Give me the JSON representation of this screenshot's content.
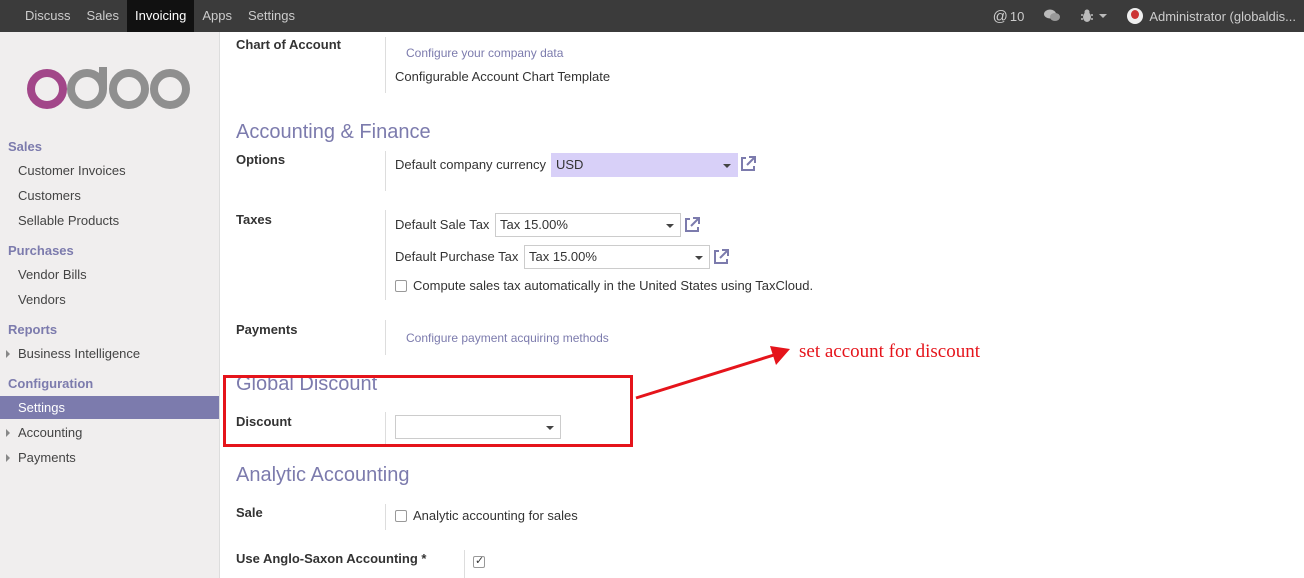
{
  "topbar": {
    "menu": [
      "Discuss",
      "Sales",
      "Invoicing",
      "Apps",
      "Settings"
    ],
    "active": "Invoicing",
    "mentions_count": "10",
    "user": "Administrator (globaldis..."
  },
  "logo_text": "odoo",
  "sidebar": {
    "sales_header": "Sales",
    "customer_invoices": "Customer Invoices",
    "customers": "Customers",
    "sellable_products": "Sellable Products",
    "purchases_header": "Purchases",
    "vendor_bills": "Vendor Bills",
    "vendors": "Vendors",
    "reports_header": "Reports",
    "business_intelligence": "Business Intelligence",
    "configuration_header": "Configuration",
    "settings": "Settings",
    "accounting": "Accounting",
    "payments": "Payments"
  },
  "content": {
    "chart_of_account_label": "Chart of Account",
    "configure_company_link": "Configure your company data",
    "chart_template": "Configurable Account Chart Template",
    "accounting_finance_title": "Accounting & Finance",
    "options_label": "Options",
    "default_currency_label": "Default company currency",
    "default_currency_value": "USD",
    "taxes_label": "Taxes",
    "default_sale_tax_label": "Default Sale Tax",
    "default_sale_tax_value": "Tax 15.00%",
    "default_purchase_tax_label": "Default Purchase Tax",
    "default_purchase_tax_value": "Tax 15.00%",
    "taxcloud_label": "Compute sales tax automatically in the United States using TaxCloud.",
    "payments_label": "Payments",
    "configure_payment_link": "Configure payment acquiring methods",
    "global_discount_title": "Global Discount",
    "discount_label": "Discount",
    "discount_value": "",
    "analytic_title": "Analytic Accounting",
    "sale_label": "Sale",
    "analytic_sales_label": "Analytic accounting for sales",
    "anglo_saxon_label": "Use Anglo-Saxon Accounting *"
  },
  "annotation": "set account for discount",
  "colors": {
    "accent": "#7c7bad",
    "annotation": "#e5141b",
    "topbar": "#3b3b3b"
  }
}
